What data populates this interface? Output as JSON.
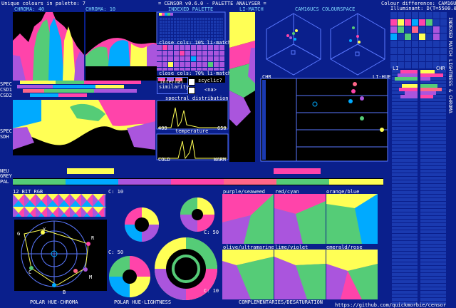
{
  "header": {
    "unique": "Unique colours in palette: 7",
    "title": "= CENSOR v0.6.0 - PALETTE ANALYSER =",
    "colour_difference": "Colour difference: CAM16UCS",
    "illuminant": "Illuminant: D(T=5500.0°K)"
  },
  "labels": {
    "chroma40": "CHROMA: 40",
    "chroma10": "CHROMA: 10",
    "indexed": "INDEXED PALETTE",
    "lihmatch": "LI-MATCH",
    "cam16": "CAM16UCS COLOURSPACE",
    "close10": "close cols: 10% li-match",
    "close70": "close cols: 70% li-match",
    "internal": "internal",
    "similarity": "similarity",
    "scyclic": "scyclic?",
    "na": "<na>",
    "spectral": "spectral distribution",
    "nm400": "400",
    "nm650": "650",
    "temperature": "temperature",
    "cold": "COLD",
    "warm": "WARM",
    "chr1": "CHR",
    "lihue": "LI-HUE",
    "li": "LI",
    "chr2": "CHR",
    "spec": "SPEC",
    "csd1": "CSD1",
    "csd2": "CSD2",
    "spec2": "SPEC",
    "sdh": "SDH",
    "neu": "NEU",
    "grey": "GREY",
    "pal": "PAL",
    "bit12": "12 BIT RGB",
    "c10a": "C: 10",
    "c50a": "C: 50",
    "c50b": "C: 50",
    "c10b": "C: 10",
    "polar_chroma": "POLAR HUE-CHROMA",
    "polar_light": "POLAR HUE-LIGHTNESS",
    "complementaries": "COMPLEMENTARIES/DESATURATION",
    "url": "https://github.com/quickmorbie/censor",
    "side": "INDEXED MATCH LIGHTNESS & CHROMA",
    "compl": [
      "purple/seaweed",
      "red/cyan",
      "orange/blue",
      "olive/ultramarine",
      "lime/violet",
      "emerald/rose"
    ],
    "hue_letters": [
      "G",
      "Y",
      "R",
      "C",
      "M",
      "B"
    ]
  },
  "palette": {
    "colors": [
      "#ffff55",
      "#ff44aa",
      "#00aaff",
      "#55cc77",
      "#aa55dd",
      "#ff6688",
      "#000000"
    ]
  }
}
